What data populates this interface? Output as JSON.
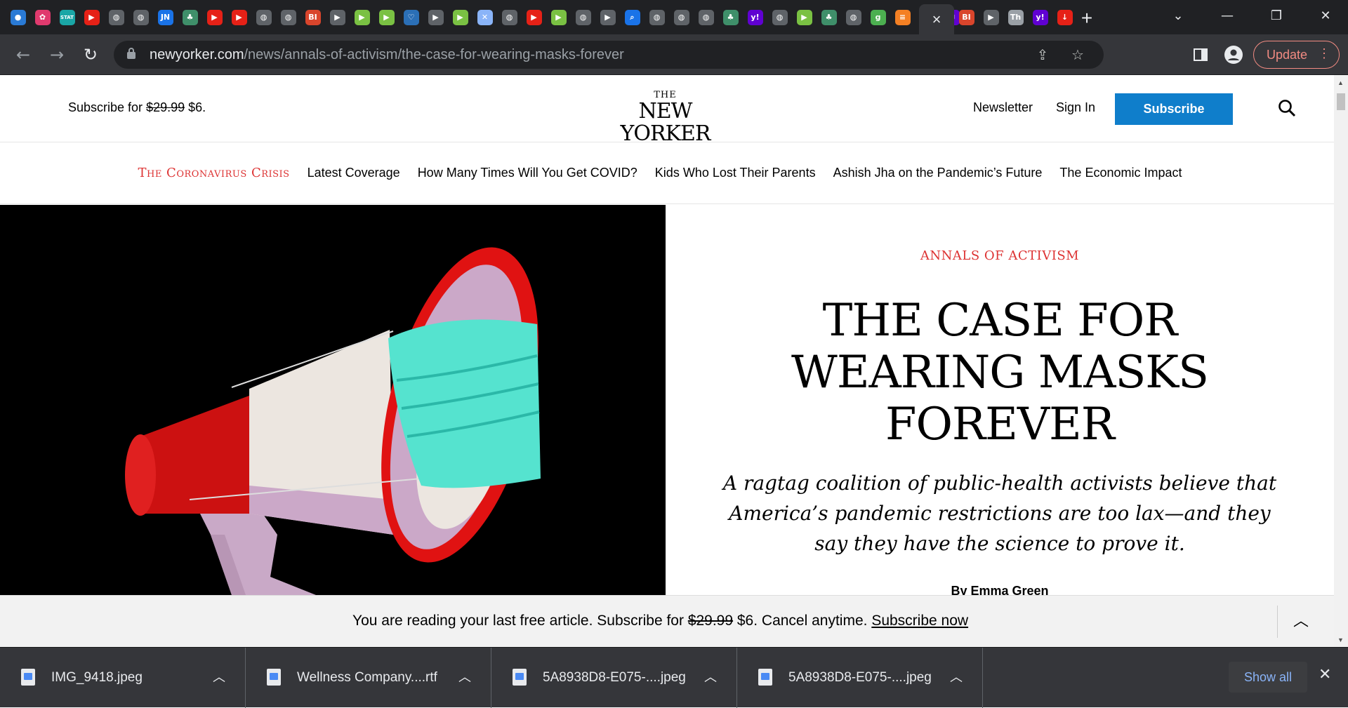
{
  "browser": {
    "tab_icons": [
      {
        "name": "globe-color-icon",
        "color": "#2a7ad5",
        "glyph": "●"
      },
      {
        "name": "pinwheel-icon",
        "color": "#e03a6e",
        "glyph": "✿"
      },
      {
        "name": "stat-icon",
        "color": "#1aa6a6",
        "glyph": "STAT"
      },
      {
        "name": "youtube-icon",
        "color": "#e62117",
        "glyph": "▶"
      },
      {
        "name": "globe-icon",
        "color": "#5f6368",
        "glyph": "◍"
      },
      {
        "name": "globe-icon",
        "color": "#5f6368",
        "glyph": "◍"
      },
      {
        "name": "jn-icon",
        "color": "#1a73e8",
        "glyph": "JN"
      },
      {
        "name": "tree-icon",
        "color": "#3f8f6a",
        "glyph": "♣"
      },
      {
        "name": "youtube-icon",
        "color": "#e62117",
        "glyph": "▶"
      },
      {
        "name": "youtube-icon",
        "color": "#e62117",
        "glyph": "▶"
      },
      {
        "name": "globe-icon",
        "color": "#5f6368",
        "glyph": "◍"
      },
      {
        "name": "globe-icon",
        "color": "#5f6368",
        "glyph": "◍"
      },
      {
        "name": "bi-icon",
        "color": "#d9452c",
        "glyph": "BI"
      },
      {
        "name": "flag-icon",
        "color": "#5f6368",
        "glyph": "▶"
      },
      {
        "name": "rumble-icon",
        "color": "#7ac143",
        "glyph": "▶"
      },
      {
        "name": "rumble-icon",
        "color": "#7ac143",
        "glyph": "▶"
      },
      {
        "name": "shield-icon",
        "color": "#2b6fb6",
        "glyph": "♡"
      },
      {
        "name": "flag-icon",
        "color": "#5f6368",
        "glyph": "▶"
      },
      {
        "name": "rumble-icon",
        "color": "#7ac143",
        "glyph": "▶"
      },
      {
        "name": "image-icon",
        "color": "#8ab4f8",
        "glyph": "✕"
      },
      {
        "name": "globe-icon",
        "color": "#5f6368",
        "glyph": "◍"
      },
      {
        "name": "youtube-icon",
        "color": "#e62117",
        "glyph": "▶"
      },
      {
        "name": "rumble-icon",
        "color": "#7ac143",
        "glyph": "▶"
      },
      {
        "name": "globe-icon",
        "color": "#5f6368",
        "glyph": "◍"
      },
      {
        "name": "flag-icon",
        "color": "#5f6368",
        "glyph": "▶"
      },
      {
        "name": "search-tab-icon",
        "color": "#1a73e8",
        "glyph": "⌕"
      },
      {
        "name": "globe-icon",
        "color": "#5f6368",
        "glyph": "◍"
      },
      {
        "name": "globe-icon",
        "color": "#5f6368",
        "glyph": "◍"
      },
      {
        "name": "globe-icon",
        "color": "#5f6368",
        "glyph": "◍"
      },
      {
        "name": "tree-icon",
        "color": "#3f8f6a",
        "glyph": "♣"
      },
      {
        "name": "yahoo-icon",
        "color": "#6001d2",
        "glyph": "y!"
      },
      {
        "name": "globe-icon",
        "color": "#5f6368",
        "glyph": "◍"
      },
      {
        "name": "rumble-icon",
        "color": "#7ac143",
        "glyph": "▶"
      },
      {
        "name": "tree-icon",
        "color": "#3f8f6a",
        "glyph": "♣"
      },
      {
        "name": "globe-icon",
        "color": "#5f6368",
        "glyph": "◍"
      },
      {
        "name": "g-icon",
        "color": "#4caf50",
        "glyph": "g"
      },
      {
        "name": "stack-icon",
        "color": "#f48024",
        "glyph": "≡"
      },
      {
        "name": "rumble-icon",
        "color": "#7ac143",
        "glyph": "▶"
      },
      {
        "name": "yahoo-mail-icon",
        "color": "#6001d2",
        "glyph": "✉"
      }
    ],
    "tabs_after_active": [
      {
        "name": "bi-icon",
        "color": "#d9452c",
        "glyph": "BI"
      },
      {
        "name": "flag-icon",
        "color": "#5f6368",
        "glyph": "▶"
      },
      {
        "name": "thinker-icon",
        "color": "#9aa0a6",
        "glyph": "Th"
      },
      {
        "name": "yahoo-icon",
        "color": "#6001d2",
        "glyph": "y!"
      },
      {
        "name": "down-arrow-icon",
        "color": "#e62117",
        "glyph": "↓"
      }
    ],
    "active_tab_close": "×",
    "new_tab": "+",
    "url_host": "newyorker.com",
    "url_path": "/news/annals-of-activism/the-case-for-wearing-masks-forever",
    "update_label": "Update"
  },
  "header": {
    "promo_prefix": "Subscribe for ",
    "promo_old_price": "$29.99",
    "promo_new_price": " $6.",
    "logo_the": "THE",
    "logo_name": "NEW YORKER",
    "newsletter": "Newsletter",
    "sign_in": "Sign In",
    "subscribe": "Subscribe"
  },
  "subnav": {
    "topic": "The Coronavirus Crisis",
    "links": [
      "Latest Coverage",
      "How Many Times Will You Get COVID?",
      "Kids Who Lost Their Parents",
      "Ashish Jha on the Pandemic’s Future",
      "The Economic Impact"
    ]
  },
  "article": {
    "rubric": "ANNALS OF ACTIVISM",
    "headline": "THE CASE FOR WEARING MASKS FOREVER",
    "dek": "A ragtag coalition of public-health activists believe that America’s pandemic restrictions are too lax—and they say they have the science to prove it.",
    "byline": "By Emma Green"
  },
  "paywall": {
    "text_prefix": "You are reading your last free article. Subscribe for ",
    "old_price": "$29.99",
    "text_suffix": " $6. Cancel anytime. ",
    "link": "Subscribe now"
  },
  "downloads": {
    "items": [
      {
        "file": "IMG_9418.jpeg"
      },
      {
        "file": "Wellness Company....rtf"
      },
      {
        "file": "5A8938D8-E075-....jpeg"
      },
      {
        "file": "5A8938D8-E075-....jpeg"
      }
    ],
    "show_all": "Show all"
  },
  "colors": {
    "accent_red": "#dd3333",
    "subscribe_blue": "#0f7ecb",
    "chrome_dark": "#202124",
    "chrome_toolbar": "#35363a",
    "update_pink": "#f28b82"
  }
}
